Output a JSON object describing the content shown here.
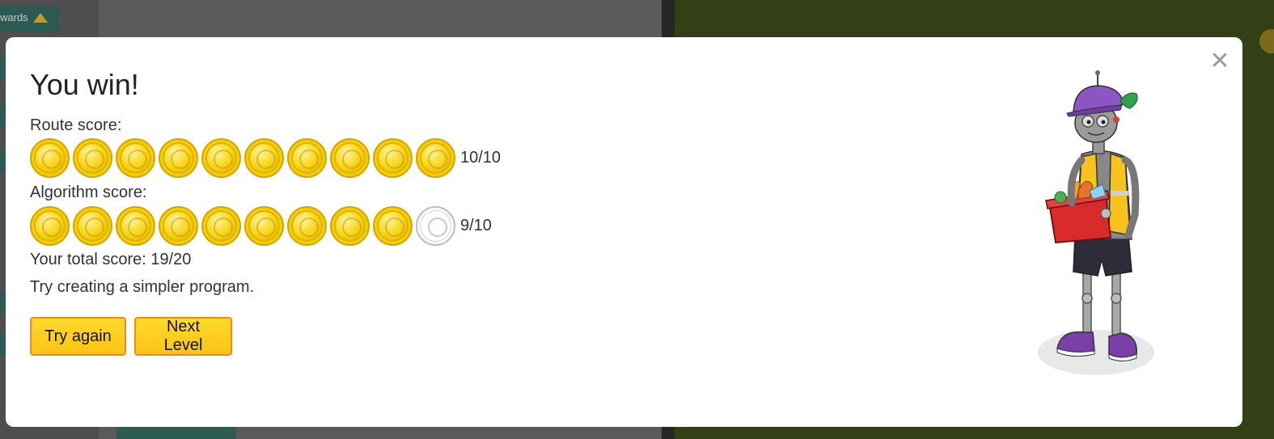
{
  "background": {
    "forwards_label": "wards"
  },
  "modal": {
    "title": "You win!",
    "close_icon": "close-icon",
    "route": {
      "label": "Route score:",
      "earned": 10,
      "total": 10,
      "score_text": "10/10"
    },
    "algorithm": {
      "label": "Algorithm score:",
      "earned": 9,
      "total": 10,
      "score_text": "9/10"
    },
    "total_score_text": "Your total score: 19/20",
    "hint": "Try creating a simpler program.",
    "buttons": {
      "try_again": "Try again",
      "next_level": "Next Level"
    },
    "illustration": "robot-delivery-character"
  },
  "colors": {
    "coin_gold": "#f8d820",
    "button_fill": "#fcc415",
    "button_border": "#f08a1c",
    "right_panel_bg": "#333f14"
  }
}
